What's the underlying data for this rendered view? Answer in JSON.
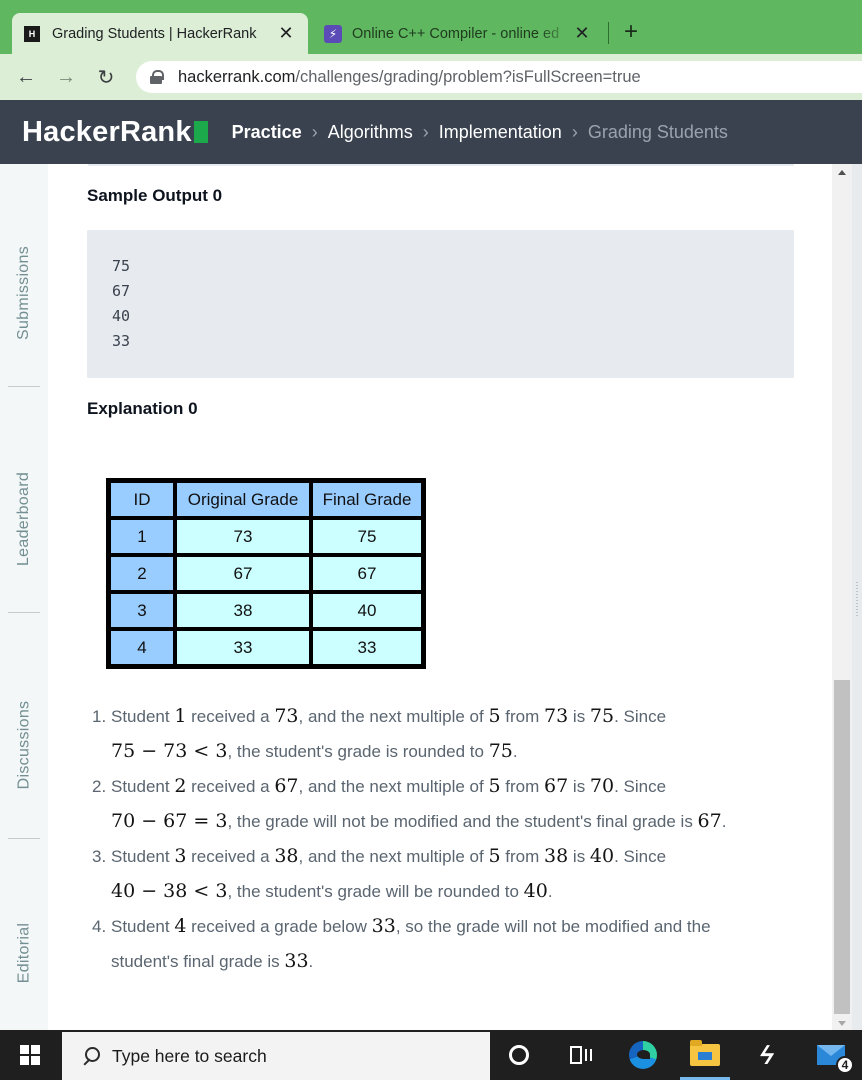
{
  "browser": {
    "tabs": [
      {
        "title": "Grading Students | HackerRank",
        "favicon": "hackerrank-icon",
        "active": true
      },
      {
        "title": "Online C++ Compiler - online ed",
        "favicon": "bolt-icon",
        "active": false
      }
    ],
    "close_glyph": "✕",
    "new_tab_glyph": "+",
    "url_host": "hackerrank.com",
    "url_path": "/challenges/grading/problem?isFullScreen=true"
  },
  "header": {
    "logo_text": "HackerRank",
    "breadcrumb": [
      "Practice",
      "Algorithms",
      "Implementation",
      "Grading Students"
    ]
  },
  "sidebar": {
    "items": [
      "Submissions",
      "Leaderboard",
      "Discussions",
      "Editorial"
    ]
  },
  "problem": {
    "sample_output_heading": "Sample Output 0",
    "sample_output_lines": [
      "75",
      "67",
      "40",
      "33"
    ],
    "explanation_heading": "Explanation 0",
    "table": {
      "headers": [
        "ID",
        "Original Grade",
        "Final Grade"
      ],
      "rows": [
        [
          "1",
          "73",
          "75"
        ],
        [
          "2",
          "67",
          "67"
        ],
        [
          "3",
          "38",
          "40"
        ],
        [
          "4",
          "33",
          "33"
        ]
      ]
    },
    "explanation": [
      {
        "num": "1.",
        "l1": {
          "a": "Student ",
          "m1": "1",
          "b": " received a ",
          "m2": "73",
          "c": ", and the next multiple of ",
          "m3": "5",
          "d": " from ",
          "m4": "73",
          "e": " is ",
          "m5": "75",
          "f": ". Since"
        },
        "l2": {
          "m1": "75 − 73 < 3",
          "a": ", the student's grade is rounded to ",
          "m2": "75",
          "b": "."
        }
      },
      {
        "num": "2.",
        "l1": {
          "a": "Student ",
          "m1": "2",
          "b": " received a ",
          "m2": "67",
          "c": ", and the next multiple of ",
          "m3": "5",
          "d": " from ",
          "m4": "67",
          "e": " is ",
          "m5": "70",
          "f": ". Since"
        },
        "l2": {
          "m1": "70 − 67 = 3",
          "a": ", the grade will not be modified and the student's final grade is ",
          "m2": "67",
          "b": "."
        }
      },
      {
        "num": "3.",
        "l1": {
          "a": "Student ",
          "m1": "3",
          "b": " received a ",
          "m2": "38",
          "c": ", and the next multiple of ",
          "m3": "5",
          "d": " from ",
          "m4": "38",
          "e": " is ",
          "m5": "40",
          "f": ". Since"
        },
        "l2": {
          "m1": "40 − 38 < 3",
          "a": ", the student's grade will be rounded to ",
          "m2": "40",
          "b": "."
        }
      },
      {
        "num": "4.",
        "l1": {
          "a": "Student ",
          "m1": "4",
          "b": " received a grade below ",
          "m2": "33",
          "c": ", so the grade will not be modified and the"
        },
        "l2": {
          "a": "student's final grade is ",
          "m1": "33",
          "b": "."
        }
      }
    ]
  },
  "taskbar": {
    "search_placeholder": "Type here to search",
    "mail_badge": "4"
  }
}
